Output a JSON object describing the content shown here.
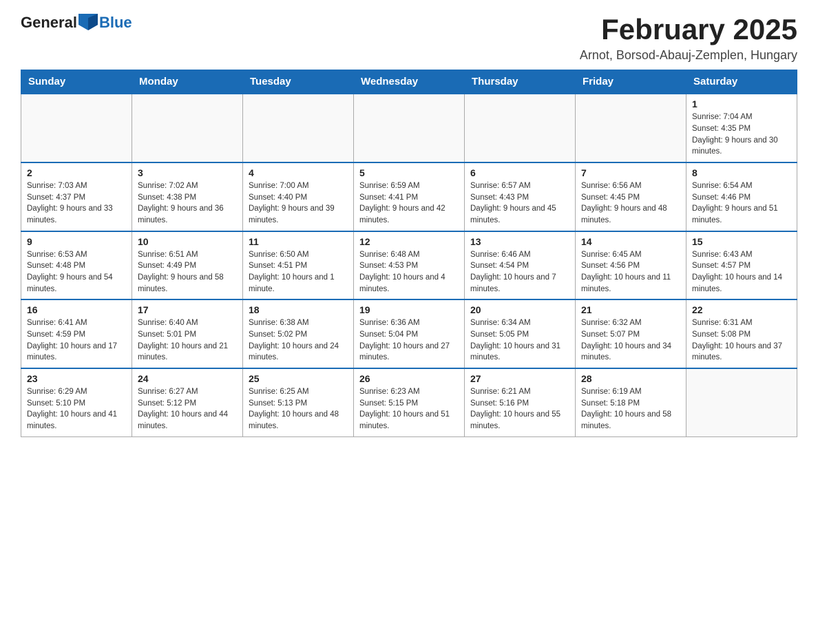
{
  "logo": {
    "general": "General",
    "blue": "Blue"
  },
  "header": {
    "title": "February 2025",
    "subtitle": "Arnot, Borsod-Abauj-Zemplen, Hungary"
  },
  "weekdays": [
    "Sunday",
    "Monday",
    "Tuesday",
    "Wednesday",
    "Thursday",
    "Friday",
    "Saturday"
  ],
  "weeks": [
    [
      {
        "day": "",
        "info": ""
      },
      {
        "day": "",
        "info": ""
      },
      {
        "day": "",
        "info": ""
      },
      {
        "day": "",
        "info": ""
      },
      {
        "day": "",
        "info": ""
      },
      {
        "day": "",
        "info": ""
      },
      {
        "day": "1",
        "info": "Sunrise: 7:04 AM\nSunset: 4:35 PM\nDaylight: 9 hours and 30 minutes."
      }
    ],
    [
      {
        "day": "2",
        "info": "Sunrise: 7:03 AM\nSunset: 4:37 PM\nDaylight: 9 hours and 33 minutes."
      },
      {
        "day": "3",
        "info": "Sunrise: 7:02 AM\nSunset: 4:38 PM\nDaylight: 9 hours and 36 minutes."
      },
      {
        "day": "4",
        "info": "Sunrise: 7:00 AM\nSunset: 4:40 PM\nDaylight: 9 hours and 39 minutes."
      },
      {
        "day": "5",
        "info": "Sunrise: 6:59 AM\nSunset: 4:41 PM\nDaylight: 9 hours and 42 minutes."
      },
      {
        "day": "6",
        "info": "Sunrise: 6:57 AM\nSunset: 4:43 PM\nDaylight: 9 hours and 45 minutes."
      },
      {
        "day": "7",
        "info": "Sunrise: 6:56 AM\nSunset: 4:45 PM\nDaylight: 9 hours and 48 minutes."
      },
      {
        "day": "8",
        "info": "Sunrise: 6:54 AM\nSunset: 4:46 PM\nDaylight: 9 hours and 51 minutes."
      }
    ],
    [
      {
        "day": "9",
        "info": "Sunrise: 6:53 AM\nSunset: 4:48 PM\nDaylight: 9 hours and 54 minutes."
      },
      {
        "day": "10",
        "info": "Sunrise: 6:51 AM\nSunset: 4:49 PM\nDaylight: 9 hours and 58 minutes."
      },
      {
        "day": "11",
        "info": "Sunrise: 6:50 AM\nSunset: 4:51 PM\nDaylight: 10 hours and 1 minute."
      },
      {
        "day": "12",
        "info": "Sunrise: 6:48 AM\nSunset: 4:53 PM\nDaylight: 10 hours and 4 minutes."
      },
      {
        "day": "13",
        "info": "Sunrise: 6:46 AM\nSunset: 4:54 PM\nDaylight: 10 hours and 7 minutes."
      },
      {
        "day": "14",
        "info": "Sunrise: 6:45 AM\nSunset: 4:56 PM\nDaylight: 10 hours and 11 minutes."
      },
      {
        "day": "15",
        "info": "Sunrise: 6:43 AM\nSunset: 4:57 PM\nDaylight: 10 hours and 14 minutes."
      }
    ],
    [
      {
        "day": "16",
        "info": "Sunrise: 6:41 AM\nSunset: 4:59 PM\nDaylight: 10 hours and 17 minutes."
      },
      {
        "day": "17",
        "info": "Sunrise: 6:40 AM\nSunset: 5:01 PM\nDaylight: 10 hours and 21 minutes."
      },
      {
        "day": "18",
        "info": "Sunrise: 6:38 AM\nSunset: 5:02 PM\nDaylight: 10 hours and 24 minutes."
      },
      {
        "day": "19",
        "info": "Sunrise: 6:36 AM\nSunset: 5:04 PM\nDaylight: 10 hours and 27 minutes."
      },
      {
        "day": "20",
        "info": "Sunrise: 6:34 AM\nSunset: 5:05 PM\nDaylight: 10 hours and 31 minutes."
      },
      {
        "day": "21",
        "info": "Sunrise: 6:32 AM\nSunset: 5:07 PM\nDaylight: 10 hours and 34 minutes."
      },
      {
        "day": "22",
        "info": "Sunrise: 6:31 AM\nSunset: 5:08 PM\nDaylight: 10 hours and 37 minutes."
      }
    ],
    [
      {
        "day": "23",
        "info": "Sunrise: 6:29 AM\nSunset: 5:10 PM\nDaylight: 10 hours and 41 minutes."
      },
      {
        "day": "24",
        "info": "Sunrise: 6:27 AM\nSunset: 5:12 PM\nDaylight: 10 hours and 44 minutes."
      },
      {
        "day": "25",
        "info": "Sunrise: 6:25 AM\nSunset: 5:13 PM\nDaylight: 10 hours and 48 minutes."
      },
      {
        "day": "26",
        "info": "Sunrise: 6:23 AM\nSunset: 5:15 PM\nDaylight: 10 hours and 51 minutes."
      },
      {
        "day": "27",
        "info": "Sunrise: 6:21 AM\nSunset: 5:16 PM\nDaylight: 10 hours and 55 minutes."
      },
      {
        "day": "28",
        "info": "Sunrise: 6:19 AM\nSunset: 5:18 PM\nDaylight: 10 hours and 58 minutes."
      },
      {
        "day": "",
        "info": ""
      }
    ]
  ]
}
